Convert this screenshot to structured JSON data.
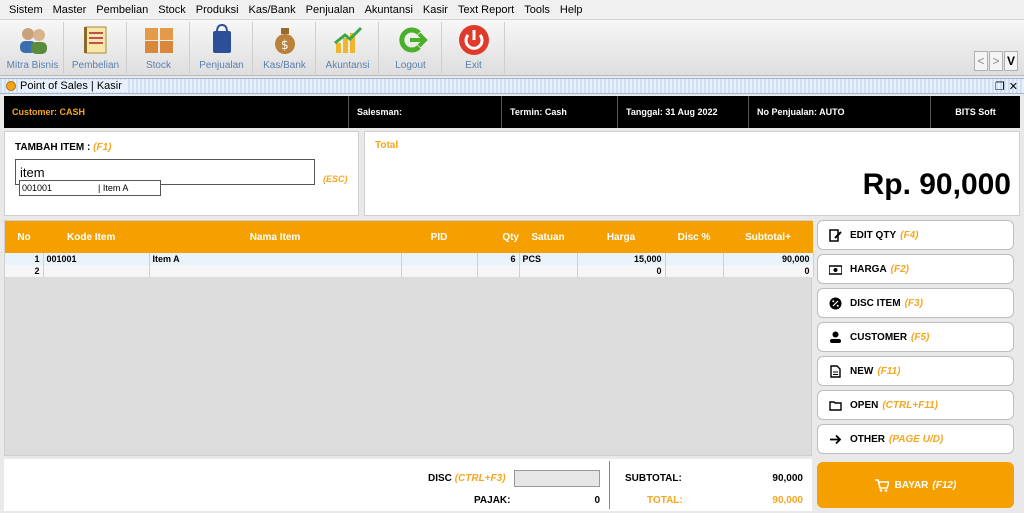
{
  "menu": [
    "Sistem",
    "Master",
    "Pembelian",
    "Stock",
    "Produksi",
    "Kas/Bank",
    "Penjualan",
    "Akuntansi",
    "Kasir",
    "Text Report",
    "Tools",
    "Help"
  ],
  "toolbar": {
    "buttons": [
      {
        "label": "Mitra Bisnis",
        "icon": "users-icon"
      },
      {
        "label": "Pembelian",
        "icon": "notebook-icon"
      },
      {
        "label": "Stock",
        "icon": "boxes-icon"
      },
      {
        "label": "Penjualan",
        "icon": "shopping-bag-icon"
      },
      {
        "label": "Kas/Bank",
        "icon": "money-bag-icon"
      },
      {
        "label": "Akuntansi",
        "icon": "growth-chart-icon"
      },
      {
        "label": "Logout",
        "icon": "logout-arrow-icon"
      },
      {
        "label": "Exit",
        "icon": "power-icon"
      }
    ],
    "nav_prev": "<",
    "nav_next": ">",
    "nav_v": "V"
  },
  "window": {
    "title": "Point of Sales | Kasir",
    "restore": "❐",
    "close": "✕"
  },
  "info": {
    "customer": "Customer: CASH",
    "salesman": "Salesman:",
    "termin": "Termin: Cash",
    "tanggal": "Tanggal: 31 Aug 2022",
    "no_penjualan": "No Penjualan: AUTO",
    "brand": "BITS Soft"
  },
  "add_item": {
    "label": "TAMBAH ITEM :",
    "shortcut": "(F1)",
    "value": "item",
    "esc": "(ESC)",
    "suggestion": {
      "code": "001001",
      "name": "| Item A"
    }
  },
  "total": {
    "label": "Total",
    "value": "Rp. 90,000"
  },
  "grid": {
    "columns": [
      "No",
      "Kode Item",
      "Nama Item",
      "PID",
      "Qty",
      "Satuan",
      "Harga",
      "Disc %",
      "Subtotal+"
    ],
    "rows": [
      {
        "no": "1",
        "kode": "001001",
        "nama": "Item A",
        "pid": "",
        "qty": "6",
        "satuan": "PCS",
        "harga": "15,000",
        "disc": "",
        "subtotal": "90,000"
      },
      {
        "no": "2",
        "kode": "",
        "nama": "",
        "pid": "",
        "qty": "",
        "satuan": "",
        "harga": "0",
        "disc": "",
        "subtotal": "0"
      }
    ]
  },
  "actions": [
    {
      "label": "EDIT QTY",
      "key": "(F4)",
      "icon": "edit-icon"
    },
    {
      "label": "HARGA",
      "key": "(F2)",
      "icon": "cash-icon"
    },
    {
      "label": "DISC ITEM",
      "key": "(F3)",
      "icon": "discount-icon"
    },
    {
      "label": "CUSTOMER",
      "key": "(F5)",
      "icon": "person-icon"
    },
    {
      "label": "NEW",
      "key": "(F11)",
      "icon": "document-icon"
    },
    {
      "label": "OPEN",
      "key": "(CTRL+F11)",
      "icon": "folder-icon"
    },
    {
      "label": "OTHER",
      "key": "(PAGE U/D)",
      "icon": "arrow-right-icon"
    }
  ],
  "pay": {
    "label": "BAYAR",
    "key": "(F12)",
    "icon": "cart-icon"
  },
  "footer": {
    "disc_label": "DISC",
    "disc_key": "(CTRL+F3)",
    "pajak_label": "PAJAK:",
    "pajak_value": "0",
    "subtotal_label": "SUBTOTAL:",
    "subtotal_value": "90,000",
    "total_label": "TOTAL:",
    "total_value": "90,000"
  },
  "colors": {
    "accent": "#f5a000",
    "header_bg": "#000000",
    "link_blue": "#5a7fb0"
  }
}
